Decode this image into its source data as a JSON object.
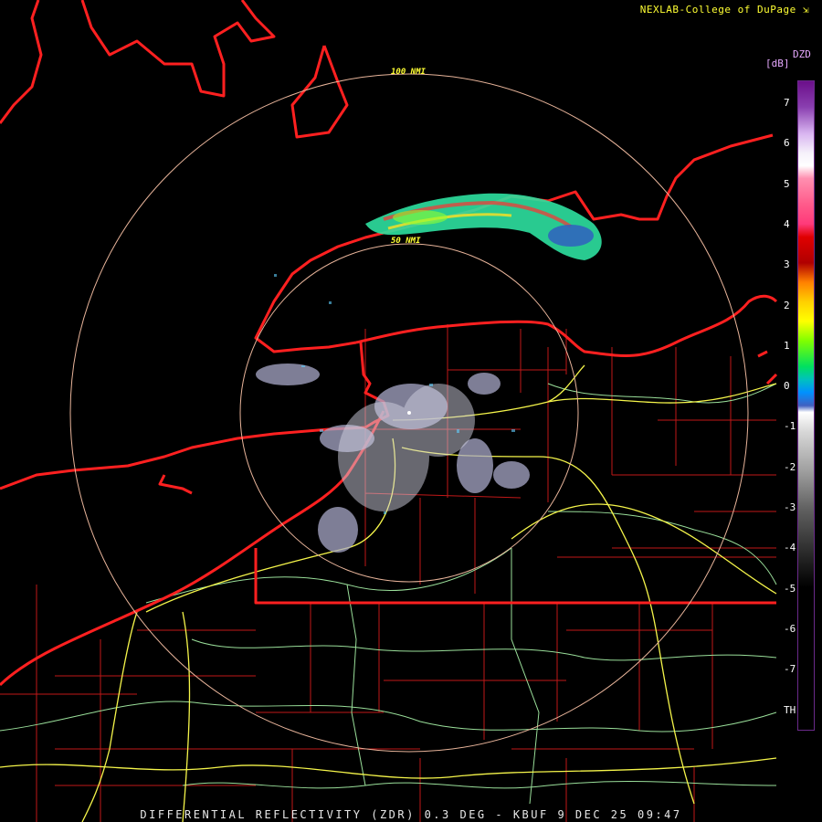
{
  "credit": "NEXLAB-College of DuPage",
  "credit_icon": "arrow-corner-icon",
  "footer": "DIFFERENTIAL REFLECTIVITY (ZDR) 0.3 DEG - KBUF 9 DEC 25 09:47",
  "legend": {
    "product": "DZD",
    "unit": "[dB]",
    "ticks": [
      "7",
      "6",
      "5",
      "4",
      "3",
      "2",
      "1",
      "0",
      "-1",
      "-2",
      "-3",
      "-4",
      "-5",
      "-6",
      "-7",
      "TH"
    ],
    "gradient": [
      {
        "stop": 0.0,
        "color": "#6b0f8a"
      },
      {
        "stop": 0.04,
        "color": "#8a3fb0"
      },
      {
        "stop": 0.08,
        "color": "#d8b4f0"
      },
      {
        "stop": 0.11,
        "color": "#f5f0fa"
      },
      {
        "stop": 0.13,
        "color": "#ffffff"
      },
      {
        "stop": 0.15,
        "color": "#ff8fb0"
      },
      {
        "stop": 0.19,
        "color": "#ff5a8a"
      },
      {
        "stop": 0.22,
        "color": "#ff3a7a"
      },
      {
        "stop": 0.24,
        "color": "#e00000"
      },
      {
        "stop": 0.28,
        "color": "#b00000"
      },
      {
        "stop": 0.31,
        "color": "#ff8000"
      },
      {
        "stop": 0.34,
        "color": "#ffd000"
      },
      {
        "stop": 0.37,
        "color": "#ffff00"
      },
      {
        "stop": 0.4,
        "color": "#80ff00"
      },
      {
        "stop": 0.44,
        "color": "#00e060"
      },
      {
        "stop": 0.46,
        "color": "#00c0c0"
      },
      {
        "stop": 0.48,
        "color": "#0090ff"
      },
      {
        "stop": 0.5,
        "color": "#4060c0"
      },
      {
        "stop": 0.51,
        "color": "#ffffff"
      },
      {
        "stop": 0.54,
        "color": "#d8d8d8"
      },
      {
        "stop": 0.6,
        "color": "#a0a0a0"
      },
      {
        "stop": 0.66,
        "color": "#606060"
      },
      {
        "stop": 0.72,
        "color": "#303030"
      },
      {
        "stop": 0.76,
        "color": "#101010"
      },
      {
        "stop": 0.78,
        "color": "#000000"
      }
    ]
  },
  "rings": [
    {
      "label": "100 NMI"
    },
    {
      "label": "50 NMI"
    }
  ],
  "colors": {
    "state_border": "#ff2020",
    "county_line": "#c01818",
    "highway": "#f5f54a",
    "road": "#9adf9a",
    "range_ring": "#e8b49a"
  }
}
